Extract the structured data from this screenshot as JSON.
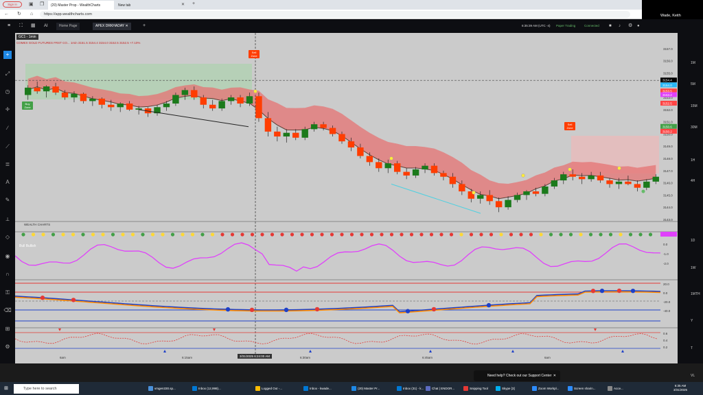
{
  "browser": {
    "sign_in": "Sign in",
    "tabs": [
      "(20) Master Prop - WealthCharts",
      "New tab"
    ],
    "url": "https://app.wealthcharts.com"
  },
  "video": {
    "name": "Wade, Keith"
  },
  "app": {
    "tabs": [
      "Home Page",
      "APEX DRKHADAY"
    ],
    "time": "6:35:39 AM  (UTC -4)",
    "paper_trading": "Paper Trading",
    "connected": "Connected"
  },
  "chart_header": {
    "symbol": "GC1 - 1min",
    "info": "COMEX GOLD FUTURES FRST CO... 1min 3151.5 3154.4 3154.0 3152.5 3152.5 +7.10%",
    "indicator1": "WEALTH CHARTS",
    "indicator2": "Bull Bullish",
    "zone_sell": "Sell Zone",
    "zone_buy": "Buy Zone"
  },
  "price_labels": [
    "3157.0",
    "3156.0",
    "3155.0",
    "3154.0",
    "3153.0",
    "3152.0",
    "3151.0",
    "3150.0",
    "3149.0",
    "3148.0",
    "3147.0",
    "3146.0",
    "3145.0",
    "3144.0",
    "3143.0"
  ],
  "price_badges": [
    {
      "text": "3154.4",
      "color": "#000000"
    },
    {
      "text": "3154.0",
      "color": "#29b6f6"
    },
    {
      "text": "3153.5",
      "color": "#ff4444"
    },
    {
      "text": "3153.2",
      "color": "#e040fb"
    },
    {
      "text": "3152.5",
      "color": "#ff4444"
    },
    {
      "text": "3150.6",
      "color": "#43a047"
    },
    {
      "text": "3150.2",
      "color": "#ff4444"
    }
  ],
  "osc_labels": [
    "0.0",
    "-1.0",
    "-2.0"
  ],
  "osc2_labels": [
    "20.0",
    "0.0",
    "-20.0",
    "-40.0"
  ],
  "osc3_labels": [
    "0.6",
    "0.4",
    "0.2"
  ],
  "time_labels": [
    "6am",
    "6:15am",
    "6:30am",
    "6:45am",
    "6am"
  ],
  "crosshair_label": "3/31/2025 6:24:00 AM",
  "timeframes": [
    "1M",
    "5M",
    "15M",
    "30M",
    "1H",
    "4H",
    "1D",
    "1W",
    "1MTH",
    "Y",
    "T",
    "VL"
  ],
  "support_text": "Need help? Check out our Support Center",
  "taskbar": {
    "search": "Type here to search",
    "items": [
      "vmgen330.sp...",
      "Inbox (12,998)...",
      "Logged Out -...",
      "Inbox - kwade...",
      "(20) Master Pr...",
      "Inbox (31) - k...",
      "Chat | ENDOR...",
      "Snipping Tool",
      "Skype [3]",
      "Zoom Workpl...",
      "Screen sharin...",
      "Acce..."
    ],
    "time": "6:35 AM",
    "date": "3/31/2025"
  },
  "chart_data": {
    "type": "candlestick",
    "ylim": [
      3143,
      3157.5
    ],
    "candles": [
      [
        3153.2,
        3154.0,
        3152.8,
        3153.8
      ],
      [
        3153.8,
        3154.3,
        3153.3,
        3153.5
      ],
      [
        3153.5,
        3154.0,
        3153.0,
        3153.9
      ],
      [
        3153.9,
        3154.2,
        3153.2,
        3153.4
      ],
      [
        3153.4,
        3153.6,
        3152.8,
        3153.0
      ],
      [
        3153.0,
        3153.5,
        3152.6,
        3153.3
      ],
      [
        3153.3,
        3153.4,
        3152.5,
        3152.7
      ],
      [
        3152.7,
        3153.1,
        3152.3,
        3152.9
      ],
      [
        3152.9,
        3153.0,
        3152.1,
        3152.4
      ],
      [
        3152.4,
        3152.8,
        3151.9,
        3152.2
      ],
      [
        3152.2,
        3152.6,
        3151.8,
        3152.5
      ],
      [
        3152.5,
        3152.7,
        3151.9,
        3152.0
      ],
      [
        3152.0,
        3152.3,
        3151.6,
        3152.1
      ],
      [
        3152.1,
        3152.2,
        3151.4,
        3151.7
      ],
      [
        3151.7,
        3152.4,
        3151.5,
        3152.2
      ],
      [
        3152.2,
        3152.7,
        3151.9,
        3152.5
      ],
      [
        3152.5,
        3153.4,
        3152.3,
        3153.2
      ],
      [
        3153.2,
        3153.8,
        3152.8,
        3153.6
      ],
      [
        3153.6,
        3153.9,
        3152.8,
        3153.0
      ],
      [
        3153.0,
        3153.2,
        3152.1,
        3152.4
      ],
      [
        3152.4,
        3152.8,
        3151.9,
        3152.1
      ],
      [
        3152.1,
        3152.9,
        3151.9,
        3152.7
      ],
      [
        3152.7,
        3153.2,
        3152.4,
        3153.0
      ],
      [
        3153.0,
        3153.2,
        3152.2,
        3152.5
      ],
      [
        3152.5,
        3153.4,
        3152.3,
        3153.1
      ],
      [
        3153.1,
        3153.4,
        3151.0,
        3151.3
      ],
      [
        3151.3,
        3151.8,
        3149.8,
        3150.2
      ],
      [
        3150.2,
        3150.6,
        3149.4,
        3149.8
      ],
      [
        3149.8,
        3150.4,
        3149.3,
        3150.1
      ],
      [
        3150.1,
        3150.4,
        3149.5,
        3149.7
      ],
      [
        3149.7,
        3150.6,
        3149.5,
        3150.4
      ],
      [
        3150.4,
        3151.0,
        3150.2,
        3150.8
      ],
      [
        3150.8,
        3151.0,
        3150.3,
        3150.5
      ],
      [
        3150.5,
        3150.7,
        3149.8,
        3150.0
      ],
      [
        3150.0,
        3150.2,
        3149.2,
        3149.4
      ],
      [
        3149.4,
        3149.7,
        3148.6,
        3148.9
      ],
      [
        3148.9,
        3149.2,
        3148.0,
        3148.2
      ],
      [
        3148.2,
        3148.5,
        3147.4,
        3147.7
      ],
      [
        3147.7,
        3148.0,
        3146.9,
        3147.2
      ],
      [
        3147.2,
        3147.9,
        3146.8,
        3147.6
      ],
      [
        3147.6,
        3147.8,
        3146.7,
        3146.9
      ],
      [
        3146.9,
        3147.2,
        3146.3,
        3146.6
      ],
      [
        3146.6,
        3147.3,
        3146.4,
        3147.1
      ],
      [
        3147.1,
        3147.6,
        3146.8,
        3147.4
      ],
      [
        3147.4,
        3147.6,
        3146.6,
        3146.8
      ],
      [
        3146.8,
        3147.0,
        3146.2,
        3146.5
      ],
      [
        3146.5,
        3146.8,
        3145.6,
        3145.9
      ],
      [
        3145.9,
        3146.2,
        3145.0,
        3145.3
      ],
      [
        3145.3,
        3145.5,
        3144.4,
        3144.7
      ],
      [
        3144.7,
        3145.3,
        3144.3,
        3145.0
      ],
      [
        3145.0,
        3145.4,
        3144.2,
        3144.5
      ],
      [
        3144.5,
        3144.8,
        3143.6,
        3144.0
      ],
      [
        3144.0,
        3144.9,
        3143.8,
        3144.6
      ],
      [
        3144.6,
        3145.2,
        3144.4,
        3145.0
      ],
      [
        3145.0,
        3145.4,
        3144.6,
        3145.3
      ],
      [
        3145.3,
        3145.6,
        3144.9,
        3145.1
      ],
      [
        3145.1,
        3145.9,
        3144.9,
        3145.7
      ],
      [
        3145.7,
        3146.4,
        3145.5,
        3146.2
      ],
      [
        3146.2,
        3146.9,
        3145.9,
        3146.7
      ],
      [
        3146.7,
        3147.1,
        3146.2,
        3146.5
      ],
      [
        3146.5,
        3146.8,
        3145.9,
        3146.3
      ],
      [
        3146.3,
        3146.9,
        3146.1,
        3146.6
      ],
      [
        3146.6,
        3146.9,
        3146.0,
        3146.2
      ],
      [
        3146.2,
        3146.4,
        3145.6,
        3145.9
      ],
      [
        3145.9,
        3146.4,
        3145.5,
        3146.1
      ],
      [
        3146.1,
        3146.6,
        3145.8,
        3145.9
      ],
      [
        3145.9,
        3146.2,
        3145.3,
        3145.6
      ],
      [
        3145.6,
        3146.3,
        3145.4,
        3146.1
      ],
      [
        3146.1,
        3146.7,
        3145.9,
        3146.5
      ]
    ]
  }
}
